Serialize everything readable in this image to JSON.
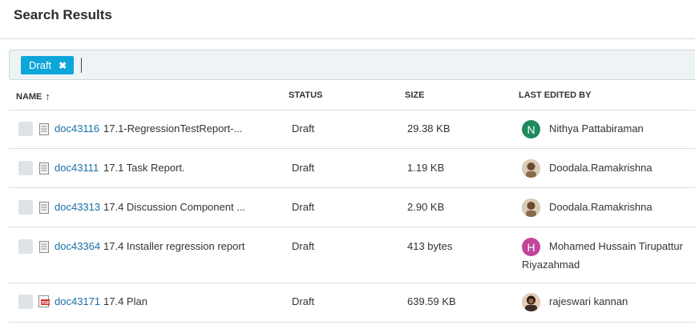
{
  "page": {
    "title": "Search Results"
  },
  "filter": {
    "chip_label": "Draft",
    "chip_remove": "✖"
  },
  "columns": {
    "name": "NAME",
    "sort": "↑",
    "status": "STATUS",
    "size": "SIZE",
    "last_edited": "LAST EDITED BY"
  },
  "colors": {
    "accent": "#0ea5d9",
    "link": "#1a6fa8",
    "avatar_green": "#1e8a5e",
    "avatar_pink": "#c2459b"
  },
  "rows": [
    {
      "id": "doc43116",
      "name": "17.1-RegressionTestReport-...",
      "status": "Draft",
      "size": "29.38 KB",
      "editor": "Nithya Pattabiraman",
      "avatar": "N",
      "icon": "document-icon"
    },
    {
      "id": "doc43111",
      "name": "17.1 Task Report.",
      "status": "Draft",
      "size": "1.19 KB",
      "editor": "Doodala.Ramakrishna",
      "avatar": "",
      "icon": "document-icon"
    },
    {
      "id": "doc43313",
      "name": "17.4 Discussion Component ...",
      "status": "Draft",
      "size": "2.90 KB",
      "editor": "Doodala.Ramakrishna",
      "avatar": "",
      "icon": "document-icon"
    },
    {
      "id": "doc43364",
      "name": "17.4 Installer regression report",
      "status": "Draft",
      "size": "413 bytes",
      "editor": "Mohamed Hussain Tirupattur Riyazahmad",
      "avatar": "H",
      "icon": "document-icon"
    },
    {
      "id": "doc43171",
      "name": "17.4 Plan",
      "status": "Draft",
      "size": "639.59 KB",
      "editor": "rajeswari kannan",
      "avatar": "",
      "icon": "pdf-icon"
    }
  ]
}
